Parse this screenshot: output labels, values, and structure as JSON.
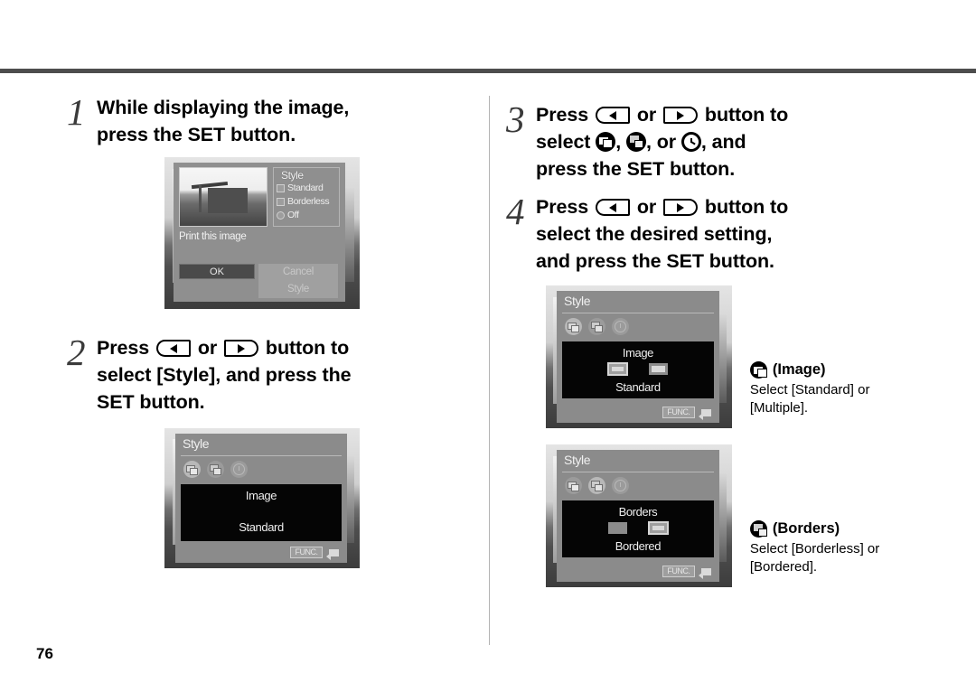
{
  "page": {
    "number": "76"
  },
  "steps": [
    {
      "number": "1",
      "text_parts": [
        "While displaying the image, press the SET button."
      ],
      "line1": "While displaying the image,",
      "line2": "press the SET button."
    },
    {
      "number": "2",
      "pre": "Press",
      "mid": "or",
      "post": "button to",
      "line2": "select [Style], and press the",
      "line3": "SET button."
    },
    {
      "number": "3",
      "pre": "Press",
      "mid": "or",
      "post": "button to",
      "line2_pre": "select",
      "line2_sep1": ",",
      "line2_sep2": ", or",
      "line2_post": ", and",
      "line3": "press the SET button."
    },
    {
      "number": "4",
      "pre": "Press",
      "mid": "or",
      "post": "button to",
      "line2": "select the desired setting,",
      "line3": "and press the SET button."
    }
  ],
  "lcd_print_dialog": {
    "panel_title": "Style",
    "rows": [
      {
        "label": "Standard",
        "swatch": "square"
      },
      {
        "label": "Borderless",
        "swatch": "square"
      },
      {
        "label": "Off",
        "swatch": "round"
      }
    ],
    "message": "Print this image",
    "ok_label": "OK",
    "cancel_label": "Cancel",
    "cancel_sub": "Style"
  },
  "lcd_style_step2": {
    "title": "Style",
    "tab_icons": [
      "image-tab-icon",
      "borders-tab-icon",
      "date-tab-icon"
    ],
    "selected_tab": 0,
    "label_top": "Image",
    "label_bottom": "Standard",
    "func_label": "FUNC.",
    "back_icon": "back-arrow-icon"
  },
  "lcd_style_image": {
    "title": "Style",
    "selected_tab": 0,
    "label_top": "Image",
    "label_bottom": "Standard",
    "choices": 2,
    "selected_choice": 0,
    "func_label": "FUNC.",
    "back_icon": "back-arrow-icon"
  },
  "lcd_style_borders": {
    "title": "Style",
    "selected_tab": 1,
    "label_top": "Borders",
    "label_bottom": "Bordered",
    "choices": 2,
    "selected_choice": 1,
    "func_label": "FUNC.",
    "back_icon": "back-arrow-icon"
  },
  "captions": [
    {
      "icon": "image-round-icon",
      "head": "(Image)",
      "body": "Select [Standard] or [Multiple]."
    },
    {
      "icon": "borders-round-icon",
      "head": "(Borders)",
      "body": "Select [Borderless] or [Bordered]."
    }
  ],
  "colors": {
    "rule": "#4d4d4d",
    "divider": "#b3b3b3",
    "step_number": "#3a3a3a",
    "text": "#000000",
    "lcd_menu_bg": "#8b8b8b",
    "lcd_black_panel": "#050505"
  }
}
